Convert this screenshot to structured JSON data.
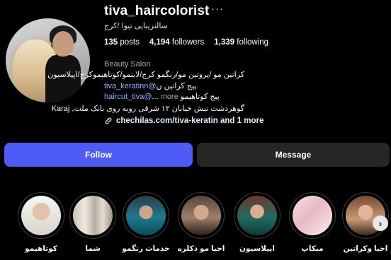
{
  "profile": {
    "username": "tiva_haircolorist",
    "more_icon": "ellipsis-icon",
    "full_name": "سالنزیبایی تیوا /کرج",
    "stats": {
      "posts_count": "135",
      "posts_label": "posts",
      "followers_count": "4,194",
      "followers_label": "followers",
      "following_count": "1,339",
      "following_label": "following"
    },
    "category": "Beauty Salon",
    "bio": {
      "line1": "کراتین مو /پروتین مو/رنگمو کرج/لایتمو/کوتاهیموکرج/اپیلاسیون",
      "line2_link": "tiva_keratinn@",
      "line2_text": "پیج کراتین ن",
      "line3_text": "پیج کوتاهیمو",
      "line3_link": "haircut_tiva@",
      "line3_ellipsis": "...",
      "line3_more": "more",
      "line4": "گوهردشت نبش خیابان ۱۲ شرقی روبه روی بانک ملت, Karaj"
    },
    "website": "chechilas.com/tiva-keratin and 1 more",
    "website_icon": "link-icon"
  },
  "actions": {
    "follow_label": "Follow",
    "message_label": "Message"
  },
  "stories": [
    {
      "label": "کوتاهیمو"
    },
    {
      "label": "شما"
    },
    {
      "label": "خدمات رنگمو"
    },
    {
      "label": "احیا مو دکلره"
    },
    {
      "label": "اپیلاسیون"
    },
    {
      "label": "میکاپ"
    },
    {
      "label": "احیا وکراتین"
    }
  ],
  "stories_next_icon": "chevron-right-icon",
  "colors": {
    "background": "#000000",
    "follow_button": "#4f5bf5",
    "message_button": "#262626",
    "link": "#8fb4ff"
  }
}
